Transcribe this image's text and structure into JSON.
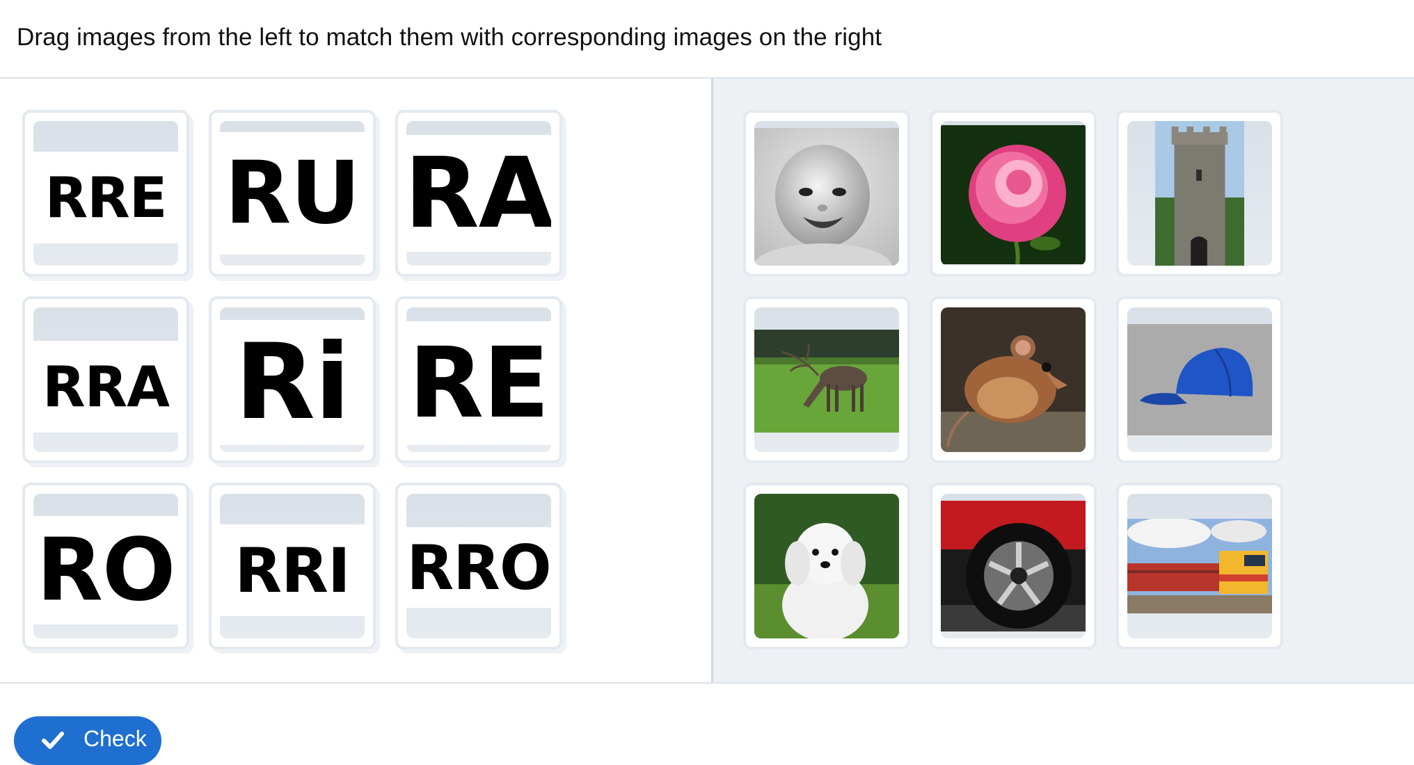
{
  "instruction": "Drag images from the left to match them with corresponding images on the right",
  "left_cards": [
    {
      "text": "RRE"
    },
    {
      "text": "RU"
    },
    {
      "text": "RA"
    },
    {
      "text": "RRA"
    },
    {
      "text": "Ri"
    },
    {
      "text": "RE"
    },
    {
      "text": "RO"
    },
    {
      "text": "RRI"
    },
    {
      "text": "RRO"
    }
  ],
  "right_images": [
    {
      "subject": "baby-photo"
    },
    {
      "subject": "rose-photo"
    },
    {
      "subject": "tower-photo"
    },
    {
      "subject": "reindeer-photo"
    },
    {
      "subject": "mouse-photo"
    },
    {
      "subject": "cap-photo"
    },
    {
      "subject": "puppy-photo"
    },
    {
      "subject": "car-wheel-photo"
    },
    {
      "subject": "train-photo"
    }
  ],
  "check_button": {
    "label": "Check",
    "icon": "check-icon",
    "color": "#1f6fd1"
  }
}
